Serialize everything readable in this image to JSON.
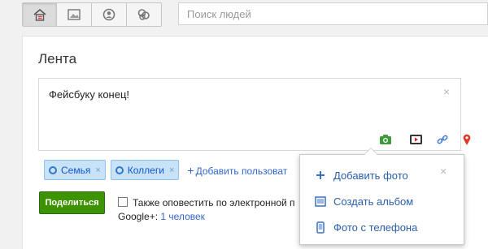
{
  "search": {
    "placeholder": "Поиск людей"
  },
  "nav": {
    "items": [
      "home-icon",
      "photos-icon",
      "profile-icon",
      "circles-icon"
    ]
  },
  "stream": {
    "title": "Лента",
    "post_text": "Фейсбуку конец!",
    "close_glyph": "×"
  },
  "attach": [
    "camera-icon",
    "video-icon",
    "link-icon",
    "location-icon"
  ],
  "audience": {
    "chips": [
      {
        "label": "Семья",
        "remove": "×"
      },
      {
        "label": "Коллеги",
        "remove": "×"
      }
    ],
    "add_plus": "+",
    "add_label": "Добавить пользоват"
  },
  "share_label": "Поделиться",
  "notify": {
    "line1": "Также оповестить по электронной п",
    "line2_prefix": "Google+:",
    "line2_link": "1 человек"
  },
  "photo_menu": {
    "close_glyph": "×",
    "items": [
      {
        "label": "Добавить фото",
        "icon": "plus-icon"
      },
      {
        "label": "Создать альбом",
        "icon": "album-icon"
      },
      {
        "label": "Фото с телефона",
        "icon": "phone-icon"
      }
    ]
  },
  "colors": {
    "share_green": "#3d9400",
    "chip_bg": "#c8e3f8",
    "link_blue": "#3366cc"
  }
}
